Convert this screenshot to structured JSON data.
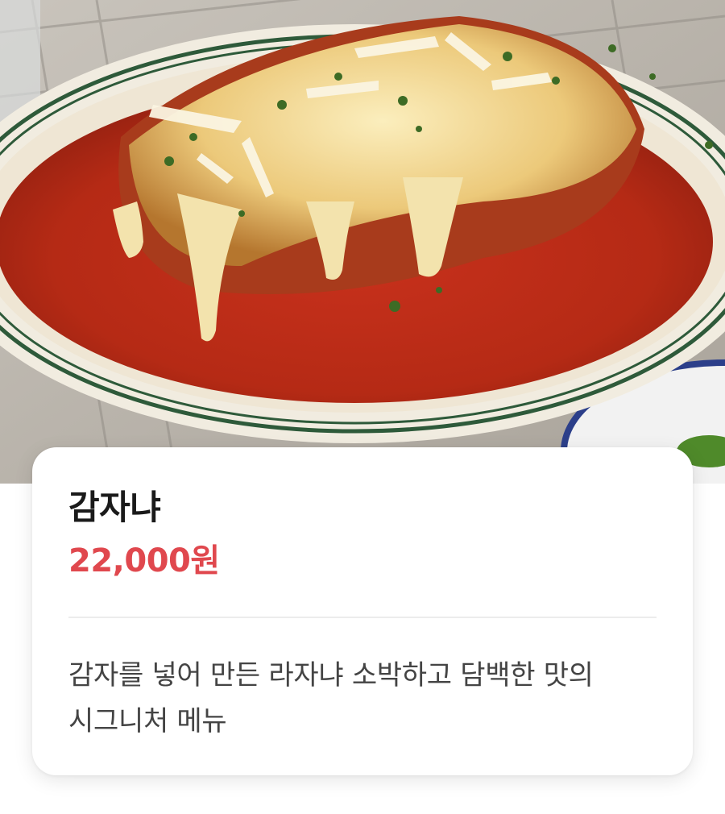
{
  "hero": {
    "image_icon": "food-photo-lasagna"
  },
  "menu_item": {
    "name": "감자냐",
    "price": "22,000원",
    "description": "감자를 넣어 만든 라자냐 소박하고 담백한 맛의 시그니처 메뉴"
  },
  "colors": {
    "price": "#e0484e",
    "name": "#1a1a1a",
    "description": "#444444",
    "card_background": "#ffffff"
  }
}
